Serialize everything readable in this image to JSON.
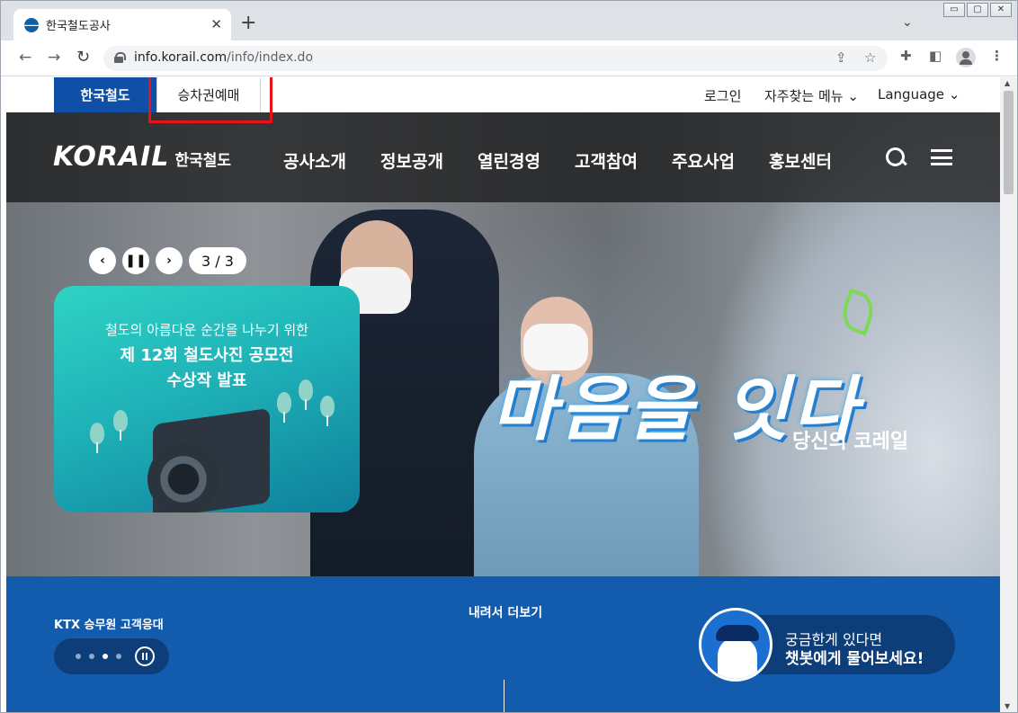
{
  "browser": {
    "tab_title": "한국철도공사",
    "tab_close": "✕",
    "new_tab": "+",
    "url_host": "info.korail.com",
    "url_path": "/info/index.do",
    "window_buttons": [
      "▭",
      "▢",
      "✕"
    ]
  },
  "utility": {
    "home_label": "한국철도",
    "ticket_label": "승차권예매",
    "login_label": "로그인",
    "faq_menu_label": "자주찾는 메뉴",
    "language_label": "Language"
  },
  "header": {
    "logo_mark": "KORAIL",
    "logo_sub": "한국철도",
    "nav": [
      "공사소개",
      "정보공개",
      "열린경영",
      "고객참여",
      "주요사업",
      "홍보센터"
    ]
  },
  "slider": {
    "counter": "3 / 3",
    "card_subtitle": "철도의 아름다운 순간을 나누기 위한",
    "card_title_line1": "제 12회 철도사진 공모전",
    "card_title_line2": "수상작 발표",
    "slogan": "마음을 잇다",
    "slogan_sub": "당신의 코레일"
  },
  "band": {
    "ktx_label": "KTX 승무원 고객응대",
    "scroll_more": "내려서 더보기",
    "chat_line1": "궁금한게 있다면",
    "chat_line2": "챗봇에게 물어보세요!"
  },
  "icons": {
    "back": "back-arrow-icon",
    "forward": "forward-arrow-icon",
    "reload": "reload-icon",
    "lock": "lock-icon",
    "share": "share-icon",
    "bookmark": "star-icon",
    "extensions": "puzzle-icon",
    "sidepanel": "side-panel-icon",
    "profile": "profile-icon",
    "menu": "kebab-menu-icon",
    "search": "search-icon",
    "hamburger": "hamburger-menu-icon"
  },
  "colors": {
    "brand_blue": "#0f4fa8",
    "band_blue": "#125bad",
    "highlight_red": "#e8131a"
  }
}
